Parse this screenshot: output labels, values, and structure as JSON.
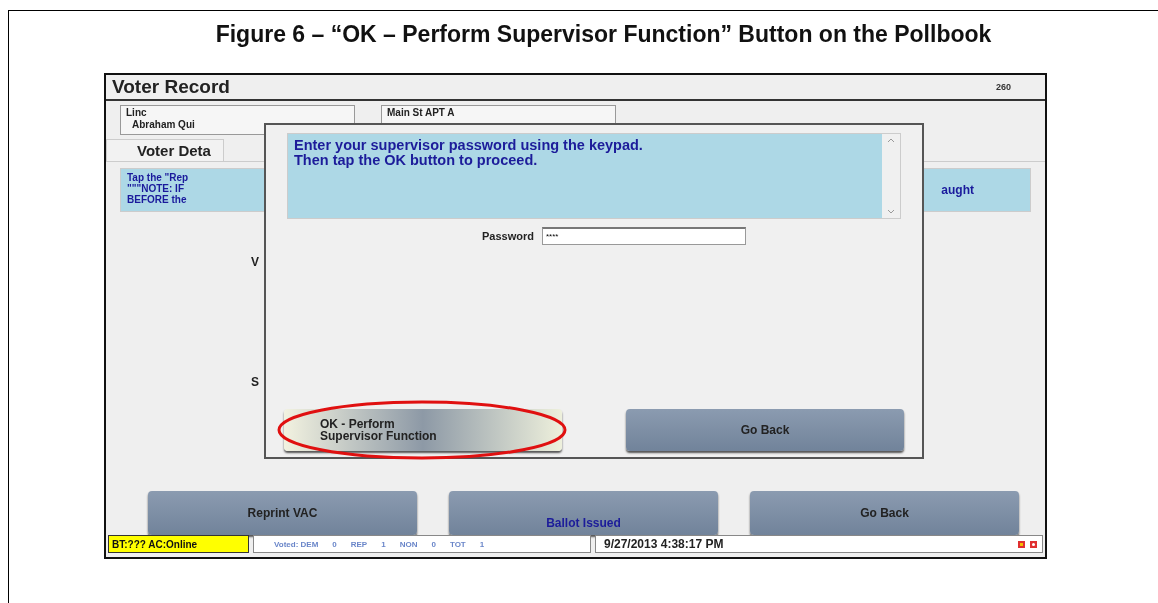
{
  "figure": {
    "caption": "Figure 6 – “OK – Perform Supervisor Function” Button on the Pollbook"
  },
  "screen": {
    "title": "Voter Record",
    "record_number": "260",
    "fields": [
      {
        "line_1": "Linc",
        "line_2": "Abraham Qui"
      },
      {
        "line_1": "Main St APT A"
      }
    ],
    "tab": {
      "label": "Voter Deta",
      "selected": true
    },
    "info": {
      "lines": [
        "Tap the \"Rep",
        "\"\"\"NOTE: IF",
        "BEFORE the"
      ],
      "right_text": "aught"
    },
    "side_labels": [
      "V",
      "S"
    ],
    "buttons": [
      {
        "label": "Reprint VAC",
        "kind": "normal"
      },
      {
        "label": "Ballot Issued",
        "kind": "accent"
      },
      {
        "label": "Go Back",
        "kind": "normal"
      }
    ],
    "status_bar": {
      "connection": "BT:??? AC:Online",
      "tally": [
        "Voted: DEM",
        "0",
        "REP",
        "1",
        "NON",
        "0",
        "TOT",
        "1"
      ],
      "datetime": "9/27/2013 4:38:17 PM"
    },
    "dialog": {
      "message": [
        "Enter your supervisor password using the keypad.",
        "Then tap the OK button to proceed."
      ],
      "password_label": "Password",
      "password_value": "****",
      "buttons": [
        {
          "label": "OK - Perform Supervisor Function",
          "kind": "highlighted"
        },
        {
          "label": "Go Back",
          "kind": "normal"
        }
      ]
    }
  }
}
